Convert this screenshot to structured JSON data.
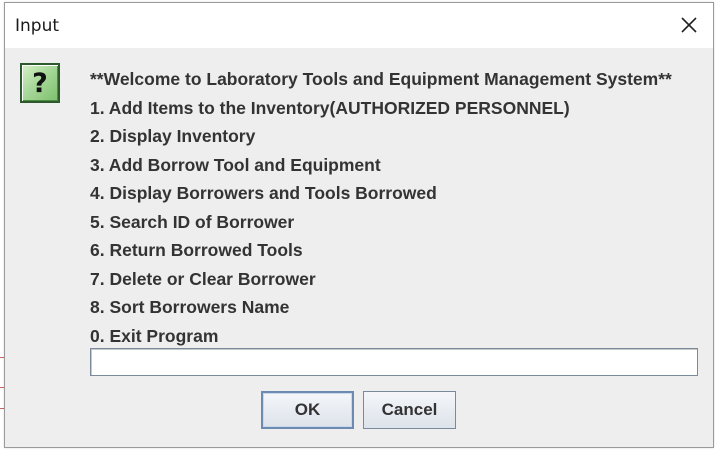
{
  "window": {
    "title": "Input"
  },
  "dialog": {
    "icon": "question-icon",
    "icon_glyph": "?",
    "message_lines": [
      "**Welcome to Laboratory Tools and Equipment Management System**",
      "1. Add Items to the Inventory(AUTHORIZED PERSONNEL)",
      "2. Display Inventory",
      "3. Add Borrow Tool and Equipment",
      "4. Display Borrowers and Tools Borrowed",
      "5. Search ID of Borrower",
      "6. Return Borrowed Tools",
      "7. Delete or Clear Borrower",
      "8. Sort Borrowers Name",
      "0. Exit Program"
    ],
    "input_value": "",
    "buttons": {
      "ok_label": "OK",
      "cancel_label": "Cancel"
    }
  },
  "colors": {
    "dialog_background": "#eeeeee",
    "icon_green": "#a8d89a",
    "focus_border": "#6d8bb0"
  }
}
